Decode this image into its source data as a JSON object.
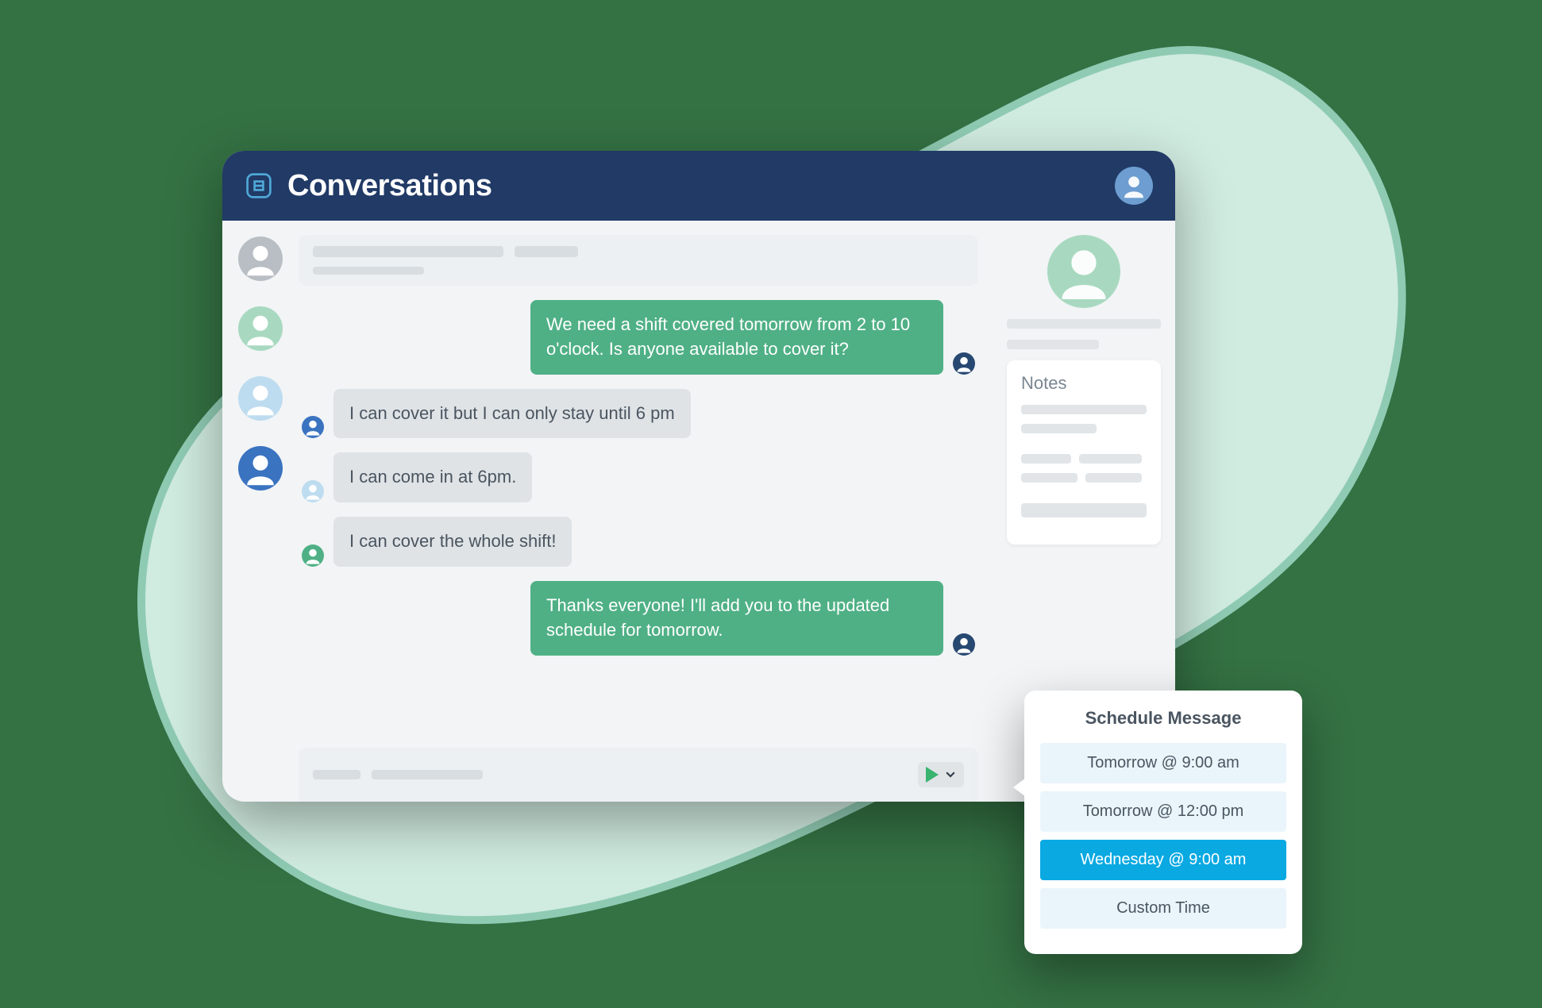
{
  "header": {
    "title": "Conversations"
  },
  "chat": {
    "messages": [
      {
        "direction": "out",
        "avatar": "dblue",
        "text": "We need a shift covered tomorrow from 2 to 10 o'clock. Is anyone available to cover it?"
      },
      {
        "direction": "in",
        "avatar": "blue",
        "text": "I can cover it but I can only stay until 6 pm"
      },
      {
        "direction": "in",
        "avatar": "lblue",
        "text": "I can come in at 6pm."
      },
      {
        "direction": "in",
        "avatar": "teal",
        "text": "I can cover the whole shift!"
      },
      {
        "direction": "out",
        "avatar": "dblue",
        "text": "Thanks everyone! I'll add you to the updated schedule for tomorrow."
      }
    ]
  },
  "notes": {
    "heading": "Notes"
  },
  "schedule": {
    "title": "Schedule Message",
    "options": [
      {
        "label": "Tomorrow @ 9:00 am",
        "selected": false
      },
      {
        "label": "Tomorrow @ 12:00 pm",
        "selected": false
      },
      {
        "label": "Wednesday @ 9:00 am",
        "selected": true
      },
      {
        "label": "Custom Time",
        "selected": false
      }
    ]
  },
  "contacts": [
    {
      "color": "grey"
    },
    {
      "color": "lgreen"
    },
    {
      "color": "lblue"
    },
    {
      "color": "blue"
    }
  ]
}
